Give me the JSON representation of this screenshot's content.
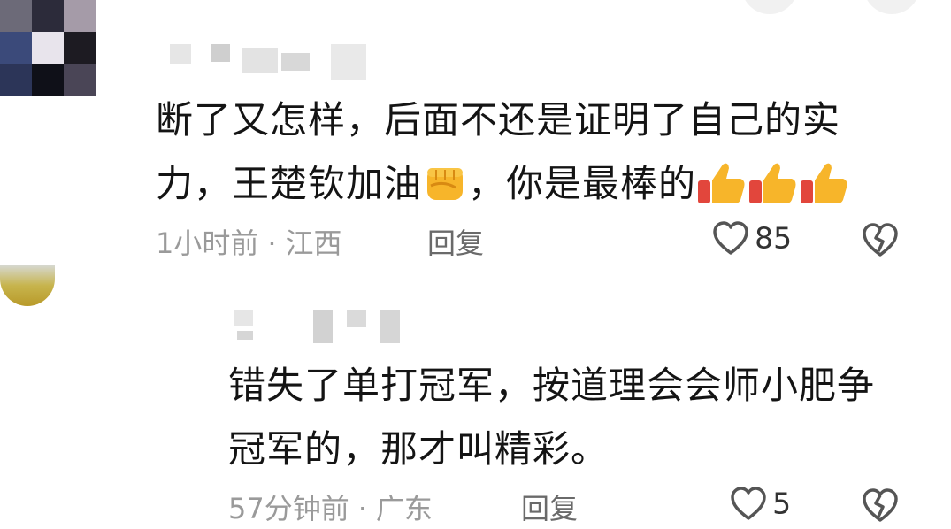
{
  "comments": [
    {
      "text_line1": "断了又怎样，后面不还是证明了自己的实",
      "text_line2_a": "力，王楚钦加油",
      "text_line2_b": "，你是最棒的",
      "time": "1小时前",
      "location": "江西",
      "reply_label": "回复",
      "like_count": "85",
      "emoji_after_a": "fist-emoji",
      "emoji_after_b": [
        "thumbs-up-emoji",
        "thumbs-up-emoji",
        "thumbs-up-emoji"
      ]
    },
    {
      "text_line1": "错失了单打冠军，按道理会会师小肥争",
      "text_line2": "冠军的，那才叫精彩。",
      "time": "57分钟前",
      "location": "广东",
      "reply_label": "回复",
      "like_count": "5"
    }
  ],
  "separator": "·",
  "colors": {
    "text": "#141414",
    "meta": "#9a9a9a",
    "icon": "#555555",
    "emoji_yellow": "#f7b52a",
    "emoji_red": "#e2463c"
  }
}
